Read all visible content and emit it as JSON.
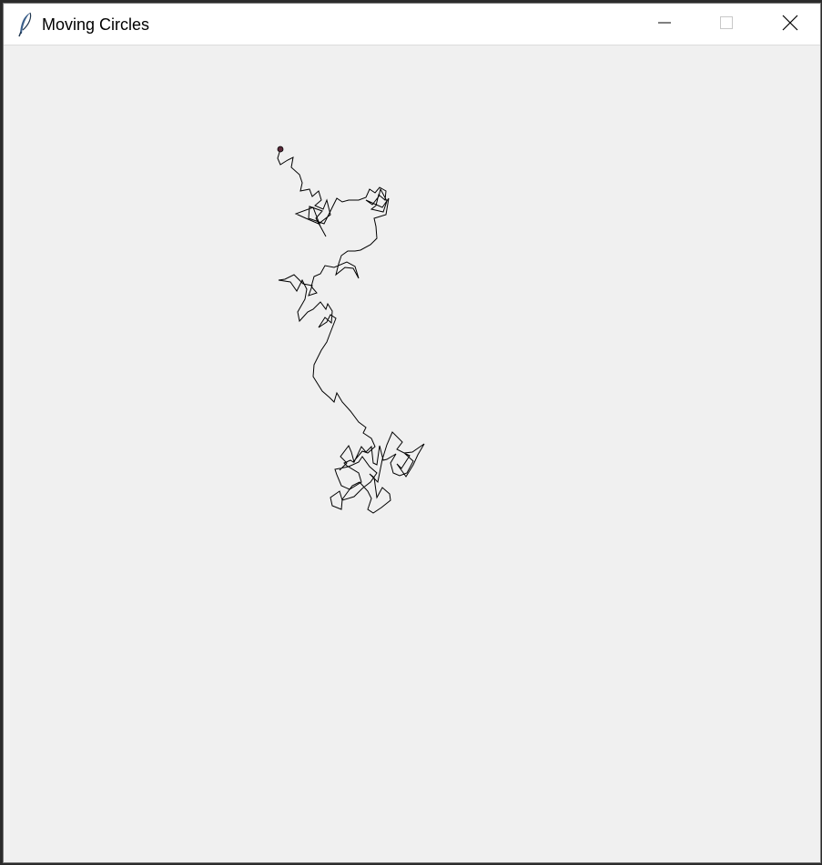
{
  "window": {
    "title": "Moving Circles",
    "app_icon": "feather-icon",
    "controls": {
      "minimize_icon": "minimize-icon",
      "maximize_icon": "maximize-icon",
      "close_icon": "close-icon"
    }
  },
  "canvas": {
    "background_color": "#f0f0f0",
    "trail_color": "#000000",
    "circle_fill": "#5a2a3a",
    "circle_stroke": "#000000"
  }
}
